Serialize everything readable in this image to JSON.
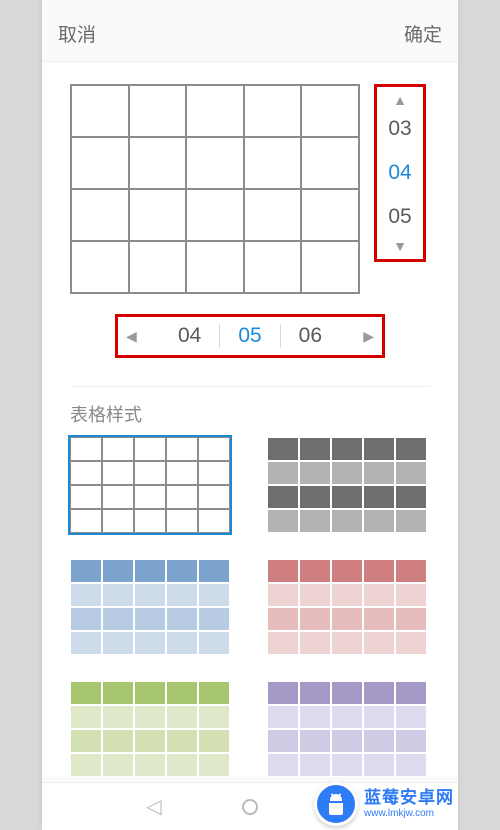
{
  "header": {
    "cancel": "取消",
    "confirm": "确定"
  },
  "preview": {
    "cols": 5,
    "rows": 4
  },
  "row_stepper": {
    "prev": "03",
    "current": "04",
    "next": "05"
  },
  "col_stepper": {
    "prev": "04",
    "current": "05",
    "next": "06"
  },
  "section_title": "表格样式",
  "table_styles": [
    {
      "name": "plain-white",
      "selected": true,
      "row_colors": [
        "#ffffff",
        "#ffffff",
        "#ffffff",
        "#ffffff"
      ],
      "border": "#8c8c8c"
    },
    {
      "name": "gray-striped",
      "selected": false,
      "row_colors": [
        "#6e6e6e",
        "#b3b3b3",
        "#6e6e6e",
        "#b3b3b3"
      ],
      "border": "#ffffff"
    },
    {
      "name": "blue-header",
      "selected": false,
      "row_colors": [
        "#7ca3cd",
        "#cddbeb",
        "#b7cce2",
        "#cddbeb"
      ],
      "border": "#ffffff"
    },
    {
      "name": "pink-header",
      "selected": false,
      "row_colors": [
        "#cf7f7f",
        "#eed3d3",
        "#e6bcbc",
        "#eed3d3"
      ],
      "border": "#ffffff"
    },
    {
      "name": "green-header",
      "selected": false,
      "row_colors": [
        "#a7c56f",
        "#dfe9c9",
        "#d2e0b3",
        "#dfe9c9"
      ],
      "border": "#ffffff"
    },
    {
      "name": "purple-header",
      "selected": false,
      "row_colors": [
        "#a59ac7",
        "#ded9ed",
        "#d1cae4",
        "#ded9ed"
      ],
      "border": "#ffffff"
    }
  ],
  "watermark": {
    "name_zh": "蓝莓安卓网",
    "name_en": "www.lmkjw.com"
  },
  "icons": {
    "arrow_up": "▲",
    "arrow_down": "▼",
    "arrow_left": "◀",
    "arrow_right": "▶",
    "tri_back": "◁"
  }
}
